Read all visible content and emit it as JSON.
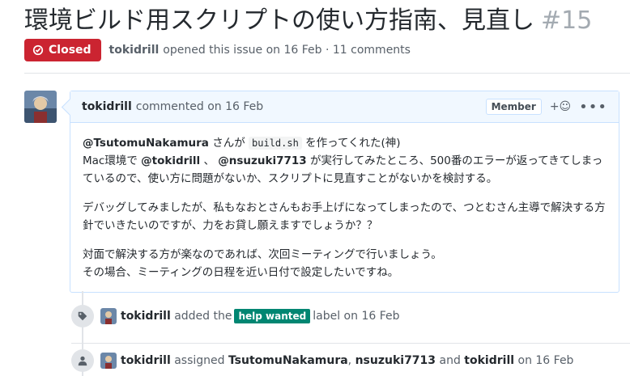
{
  "issue": {
    "title": "環境ビルド用スクリプトの使い方指南、見直し",
    "number": "#15",
    "state": "Closed",
    "author": "tokidrill",
    "opened_text": "opened this issue on 16 Feb · 11 comments"
  },
  "comment": {
    "author": "tokidrill",
    "action": "commented on 16 Feb",
    "role_badge": "Member",
    "reaction_glyph": "+☺",
    "menu_glyph": "•••",
    "para1": {
      "mention1": "@TsutomuNakamura",
      "t1": " さんが ",
      "code": "build.sh",
      "t2": " を作ってくれた(神)",
      "t3": "Mac環境で ",
      "mention2": "@tokidrill",
      "t4": " 、 ",
      "mention3": "@nsuzuki7713",
      "t5": " が実行してみたところ、500番のエラーが返ってきてしまっているので、使い方に問題がないか、スクリプトに見直すことがないかを検討する。"
    },
    "para2": "デバッグしてみましたが、私もなおとさんもお手上げになってしまったので、つとむさん主導で解決する方針でいきたいのですが、力をお貸し願えますでしょうか？？",
    "para3_line1": "対面で解決する方が楽なのであれば、次回ミーティングで行いましょう。",
    "para3_line2": "その場合、ミーティングの日程を近い日付で設定したいですね。"
  },
  "events": [
    {
      "icon": "tag-icon",
      "actor": "tokidrill",
      "pre": "added the",
      "label": "help wanted",
      "post": "label on 16 Feb",
      "label_color": "#008672"
    },
    {
      "icon": "person-icon",
      "actor": "tokidrill",
      "pre": "assigned",
      "assignee1": "TsutomuNakamura",
      "comma": ",",
      "assignee2": "nsuzuki7713",
      "and": "and",
      "assignee3": "tokidrill",
      "post": "on 16 Feb"
    }
  ],
  "colors": {
    "closed": "#cb2431",
    "comment_border": "#c8e1ff",
    "comment_header": "#f1f8ff"
  }
}
